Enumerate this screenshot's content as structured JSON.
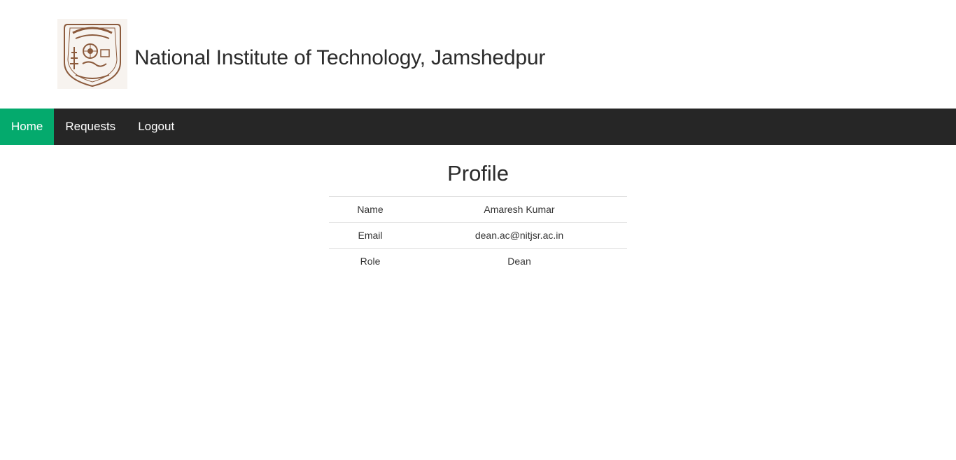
{
  "header": {
    "logo_icon": "nit-jamshedpur-emblem",
    "title": "National Institute of Technology, Jamshedpur"
  },
  "nav": {
    "items": [
      {
        "label": "Home",
        "active": true
      },
      {
        "label": "Requests",
        "active": false
      },
      {
        "label": "Logout",
        "active": false
      }
    ],
    "active_color": "#04aa6d",
    "bar_color": "#262626"
  },
  "profile": {
    "title": "Profile",
    "rows": [
      {
        "key": "Name",
        "value": "Amaresh Kumar"
      },
      {
        "key": "Email",
        "value": "dean.ac@nitjsr.ac.in"
      },
      {
        "key": "Role",
        "value": "Dean"
      }
    ]
  }
}
